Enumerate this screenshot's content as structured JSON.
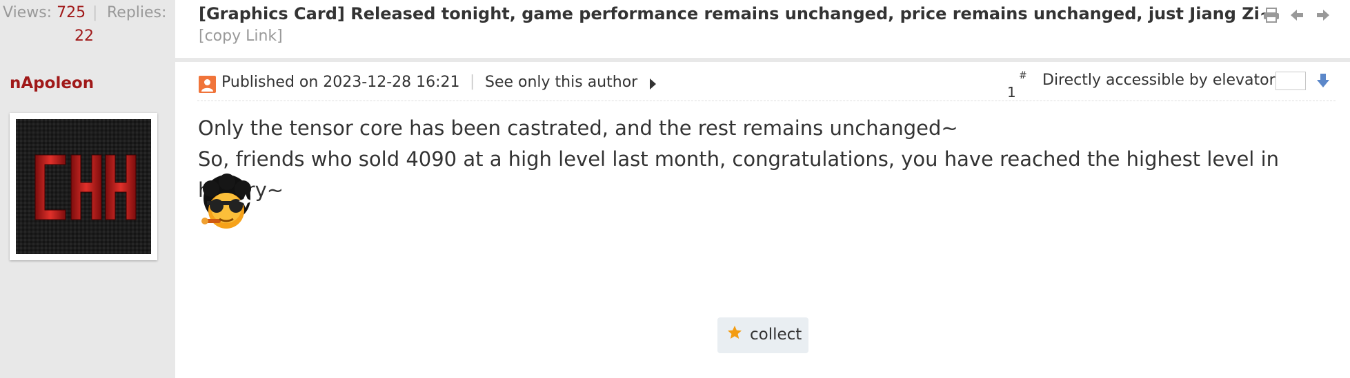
{
  "stats": {
    "views_label": "Views:",
    "views_count": "725",
    "separator": "|",
    "replies_label": "Replies:",
    "replies_count": "22"
  },
  "thread": {
    "title": "[Graphics Card] Released tonight, game performance remains unchanged, price remains unchanged, just Jiang Zi~",
    "copy_link": "[copy Link]",
    "icons": [
      "print-icon",
      "arrow-left-icon",
      "arrow-right-icon"
    ]
  },
  "author": {
    "name": "nApoleon",
    "avatar_text": "CHH"
  },
  "post": {
    "published": "Published on 2023-12-28 16:21",
    "separator": "|",
    "see_only_author": "See only this author",
    "floor": "1",
    "floor_symbol": "#",
    "elevator_label": "Directly accessible by elevator",
    "elevator_value": "",
    "lines": [
      "Only the tensor core has been castrated, and the rest remains unchanged~",
      "So, friends who sold 4090 at a high level last month, congratulations, you have reached the highest level in history~"
    ],
    "emoji": "cool-afro-sunglasses-emoji"
  },
  "actions": {
    "collect_label": "collect"
  },
  "colors": {
    "accent": "#a01919",
    "sidebar_bg": "#e8e8e8",
    "muted": "#999999",
    "icon_blue": "#5b87c9",
    "star": "#f39c12"
  }
}
